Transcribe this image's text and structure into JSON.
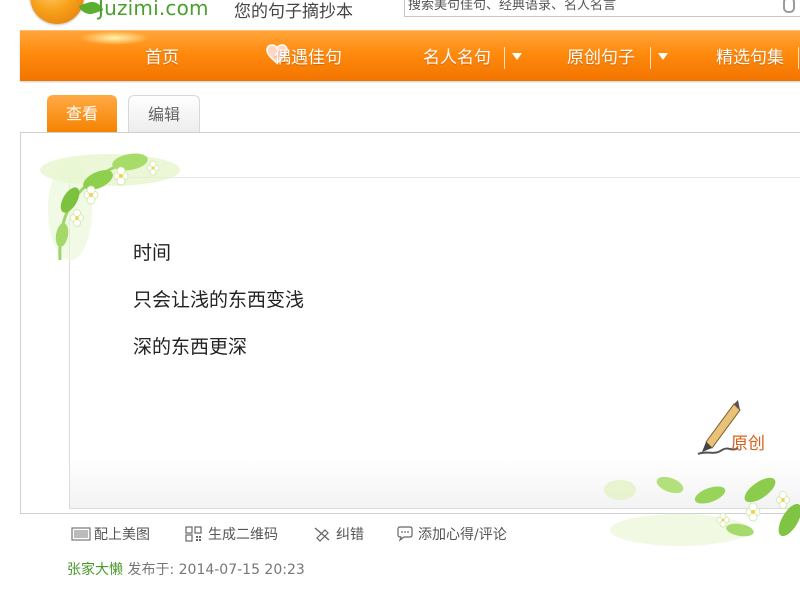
{
  "header": {
    "logo_text": "Juzimi.com",
    "slogan": "您的句子摘抄本",
    "search_placeholder": "搜索美句佳句、经典语录、名人名言"
  },
  "nav": {
    "items": [
      {
        "label": "首页"
      },
      {
        "label": "偶遇佳句"
      },
      {
        "label": "名人名句"
      },
      {
        "label": "原创句子"
      },
      {
        "label": "精选句集"
      }
    ]
  },
  "tabs": {
    "view": "查看",
    "edit": "编辑"
  },
  "quote": {
    "lines": [
      "时间",
      "只会让浅的东西变浅",
      "深的东西更深"
    ],
    "badge": "原创"
  },
  "actions": {
    "pair_image": "配上美图",
    "qr_code": "生成二维码",
    "report_error": "纠错",
    "comment": "添加心得/评论"
  },
  "author": {
    "name": "张家大懒",
    "published_label": "发布于:",
    "timestamp": "2014-07-15 20:23"
  },
  "colors": {
    "nav_orange": "#ff8a0d",
    "brand_green": "#4aa02c",
    "badge_orange": "#d9601a"
  },
  "icons": [
    "orange-logo-icon",
    "mic-icon",
    "heart-icon",
    "dropdown-caret-icon",
    "pen-icon",
    "picture-icon",
    "qr-code-icon",
    "correct-icon",
    "comment-icon"
  ]
}
